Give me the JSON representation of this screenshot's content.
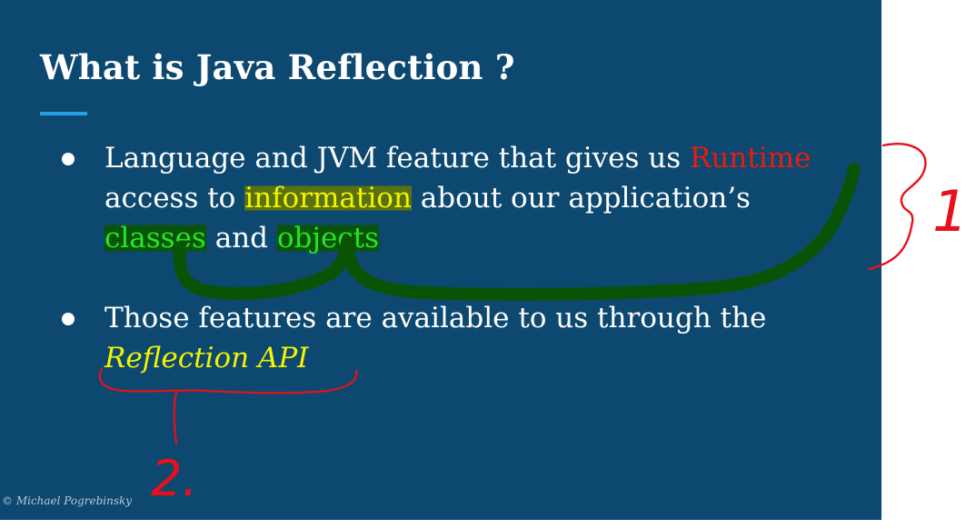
{
  "slide": {
    "title": "What is Java Reflection ?",
    "bullets": [
      {
        "line1_pre": "Language and JVM feature that gives us ",
        "line1_red": "Runtime",
        "line2_pre": "access to ",
        "line2_yellow": "information",
        "line2_post": " about our application’s",
        "line3_green1": "classes",
        "line3_mid": " and ",
        "line3_green2": "objects"
      },
      {
        "line1": "Those features are available to us through the",
        "line2_italic": "Reflection API"
      }
    ],
    "footer": "© Michael Pogrebinsky"
  },
  "annotations": {
    "label_1": "1.",
    "label_2": "2."
  },
  "colors": {
    "slide_bg": "#0d4870",
    "accent_rule": "#22a1e0",
    "runtime": "#ea1c10",
    "highlight_yellow": "#f4f400",
    "highlight_green": "#24e820",
    "pen_red": "#e8101a",
    "pen_green": "#0a5400"
  }
}
